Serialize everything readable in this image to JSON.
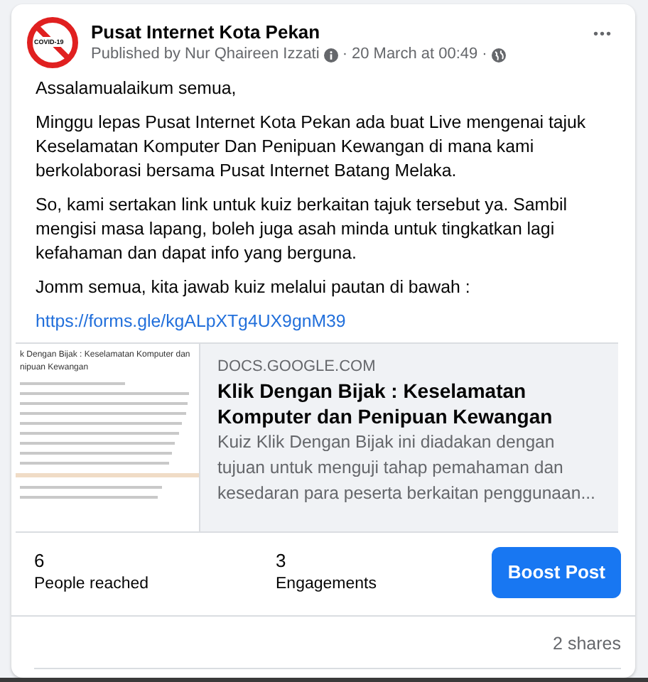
{
  "post": {
    "page_name": "Pusat Internet Kota Pekan",
    "avatar": {
      "label": "COVID-19"
    },
    "meta": {
      "published_by": "Published by Nur Qhaireen Izzati",
      "separator": "·",
      "time": "20 March at 00:49",
      "separator_2": "·"
    },
    "more": "•••",
    "paragraphs": [
      "Assalamualaikum semua,",
      "Minggu lepas Pusat Internet Kota Pekan ada buat Live mengenai tajuk Keselamatan Komputer Dan Penipuan Kewangan di mana kami berkolaborasi bersama Pusat Internet Batang Melaka.",
      "So, kami sertakan link untuk kuiz berkaitan tajuk tersebut ya. Sambil mengisi masa lapang, boleh juga asah minda untuk tingkatkan lagi kefahaman dan dapat info yang berguna.",
      "Jomm semua, kita jawab kuiz melalui pautan di bawah :"
    ],
    "link": "https://forms.gle/kgALpXTg4UX9gnM39",
    "preview": {
      "thumbnail_title": "k Dengan Bijak : Keselamatan Komputer dan nipuan Kewangan",
      "domain": "DOCS.GOOGLE.COM",
      "title": "Klik Dengan Bijak : Keselamatan Komputer dan Penipuan Kewangan",
      "description": "Kuiz Klik Dengan Bijak ini diadakan dengan tujuan untuk menguji tahap pemahaman dan kesedaran para peserta berkaitan penggunaan..."
    },
    "stats": [
      {
        "value": "6",
        "label": "People reached"
      },
      {
        "value": "3",
        "label": "Engagements"
      }
    ],
    "boost_button": "Boost Post",
    "shares": "2 shares"
  }
}
